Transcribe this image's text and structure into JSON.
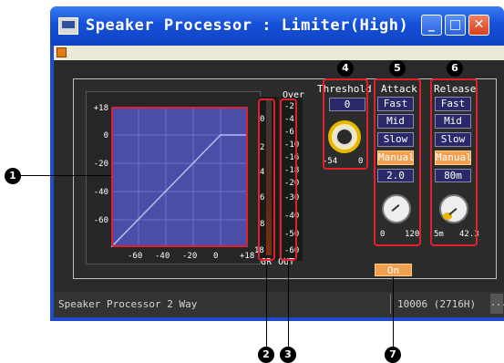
{
  "window": {
    "title": "Speaker Processor : Limiter(High)",
    "minimize_glyph": "_",
    "maximize_glyph": "□",
    "close_glyph": "✕"
  },
  "graph": {
    "y_labels": [
      "+18",
      "0",
      "-20",
      "-40",
      "-60"
    ],
    "x_labels": [
      "-60",
      "-40",
      "-20",
      "0",
      "+18"
    ]
  },
  "meter_gr": {
    "labels": [
      "0",
      "2",
      "4",
      "6",
      "8",
      "18"
    ],
    "caption": "GR"
  },
  "meter_out": {
    "over_label": "Over",
    "labels": [
      "-2",
      "-4",
      "-6",
      "-10",
      "-16",
      "-18",
      "-20",
      "-30",
      "-40",
      "-50",
      "-60"
    ],
    "caption": "OUT"
  },
  "threshold": {
    "label": "Threshold",
    "value": "0",
    "min": "-54",
    "max": "0"
  },
  "attack": {
    "label": "Attack",
    "buttons": [
      "Fast",
      "Mid",
      "Slow",
      "Manual"
    ],
    "selected": "Manual",
    "value": "2.0",
    "min": "0",
    "max": "120"
  },
  "release": {
    "label": "Release",
    "buttons": [
      "Fast",
      "Mid",
      "Slow",
      "Manual"
    ],
    "selected": "Manual",
    "value": "80m",
    "min": "5m",
    "max": "42.3"
  },
  "on_button": "On",
  "status": {
    "left": "Speaker Processor  2 Way",
    "right": "10006 (2716H)",
    "ellipsis": "..."
  },
  "callouts": [
    "1",
    "2",
    "3",
    "4",
    "5",
    "6",
    "7"
  ],
  "colors": {
    "title_bar": "#1650d8",
    "graph_bg": "#4a4ea8",
    "manual_selected": "#f0a050",
    "highlight_red": "#e0202a",
    "knob_ring_yellow": "#e8b800"
  }
}
